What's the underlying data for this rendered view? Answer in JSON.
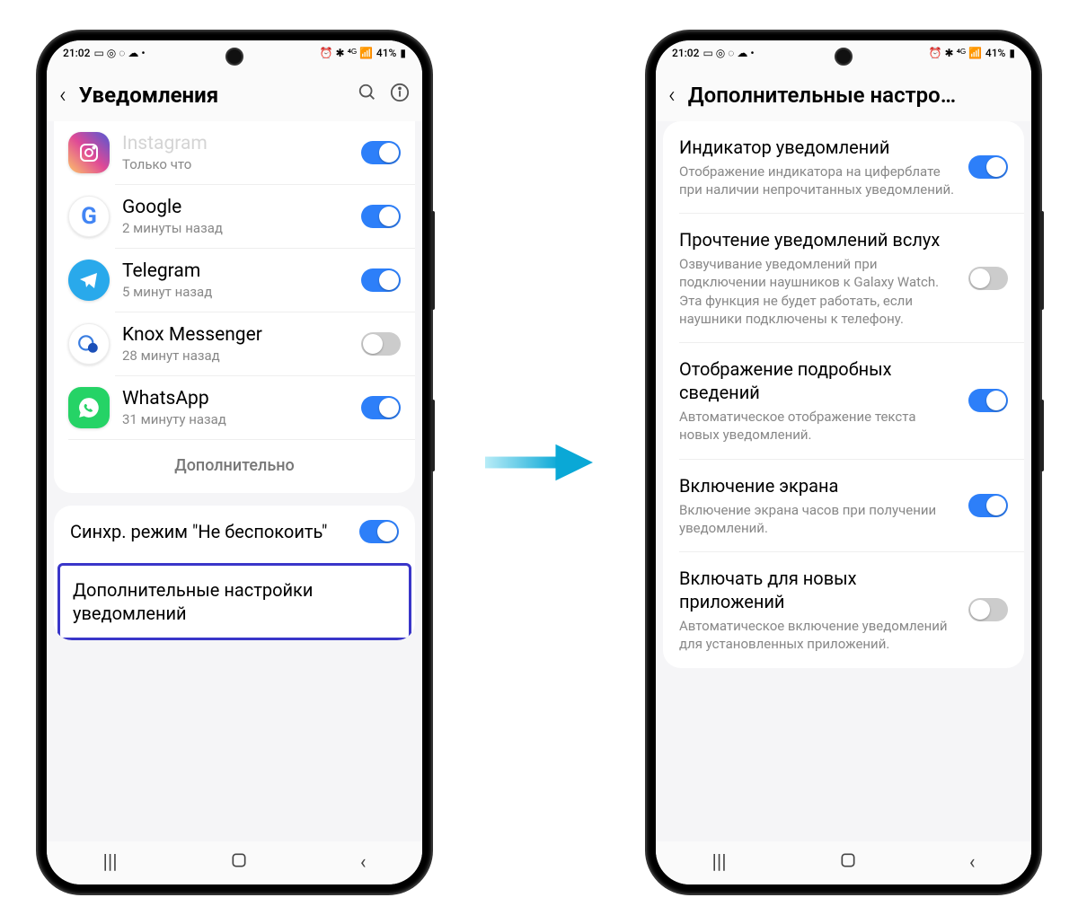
{
  "status": {
    "time": "21:02",
    "battery": "41%"
  },
  "phone1": {
    "header_title": "Уведомления",
    "apps": [
      {
        "name": "Instagram",
        "sub": "Только что",
        "icon": "instagram",
        "on": true,
        "cut": true
      },
      {
        "name": "Google",
        "sub": "2 минуты назад",
        "icon": "google",
        "on": true
      },
      {
        "name": "Telegram",
        "sub": "5 минут назад",
        "icon": "telegram",
        "on": true
      },
      {
        "name": "Knox Messenger",
        "sub": "28 минут назад",
        "icon": "knox",
        "on": false
      },
      {
        "name": "WhatsApp",
        "sub": "31 минуту назад",
        "icon": "whatsapp",
        "on": true
      }
    ],
    "more_label": "Дополнительно",
    "sync_dnd": "Синхр. режим \"Не беспокоить\"",
    "advanced_settings": "Дополнительные настройки уведомлений"
  },
  "phone2": {
    "header_title": "Дополнительные настро…",
    "settings": [
      {
        "title": "Индикатор уведомлений",
        "sub": "Отображение индикатора на циферблате при наличии непрочитанных уведомлений.",
        "on": true
      },
      {
        "title": "Прочтение уведомлений вслух",
        "sub": "Озвучивание уведомлений при подключении наушников к Galaxy Watch. Эта функция не будет работать, если наушники подключены к телефону.",
        "on": false
      },
      {
        "title": "Отображение подробных сведений",
        "sub": "Автоматическое отображение текста новых уведомлений.",
        "on": true
      },
      {
        "title": "Включение экрана",
        "sub": "Включение экрана часов при получении уведомлений.",
        "on": true
      },
      {
        "title": "Включать для новых приложений",
        "sub": "Автоматическое включение уведомлений для установленных приложений.",
        "on": false
      }
    ]
  }
}
